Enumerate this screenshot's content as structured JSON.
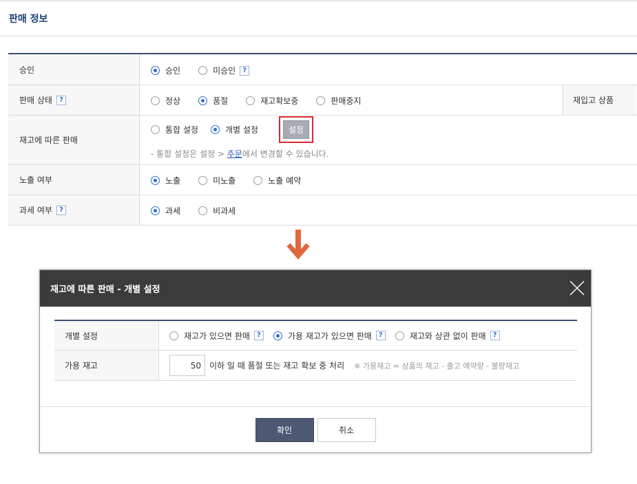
{
  "section": {
    "title": "판매 정보"
  },
  "form": {
    "rows": [
      {
        "label": "승인",
        "options": [
          "승인",
          "미승인"
        ],
        "selected": 0
      },
      {
        "label": "판매 상태",
        "options": [
          "정상",
          "품절",
          "재고확보중",
          "판매중지"
        ],
        "selected": 1,
        "side_label": "재입고 상품"
      },
      {
        "label": "재고에 따른 판매",
        "options": [
          "통합 설정",
          "개별 설정"
        ],
        "selected": 1,
        "button": "설정",
        "note_prefix": "-  통합 설정은 설정 > ",
        "note_link": "주문",
        "note_suffix": "에서 변경할 수 있습니다."
      },
      {
        "label": "노출 여부",
        "options": [
          "노출",
          "미노출",
          "노출 예약"
        ],
        "selected": 0
      },
      {
        "label": "과세 여부",
        "options": [
          "과세",
          "비과세"
        ],
        "selected": 0
      }
    ],
    "help_icon": "?"
  },
  "modal": {
    "title": "재고에 따른 판매 - 개별 설정",
    "rows": [
      {
        "label": "개별 설정",
        "options": [
          "재고가 있으면 판매",
          "가용 재고가 있으면 판매",
          "재고와 상관 없이 판매"
        ],
        "selected": 1
      },
      {
        "label": "가용 재고",
        "value": "50",
        "suffix": "이하 일 때 품절 또는 재고 확보 중 처리",
        "note": "※ 가용재고 = 상품의 재고 - 출고 예약량 - 불량재고"
      }
    ],
    "confirm_label": "확인",
    "cancel_label": "취소"
  },
  "colors": {
    "accent": "#2c6ccc",
    "highlight": "#d9282f",
    "arrow": "#e0683f",
    "header": "#3b3b3b"
  },
  "icons": {
    "close": "close-icon",
    "arrow": "arrow-down-icon",
    "help": "help-icon"
  }
}
